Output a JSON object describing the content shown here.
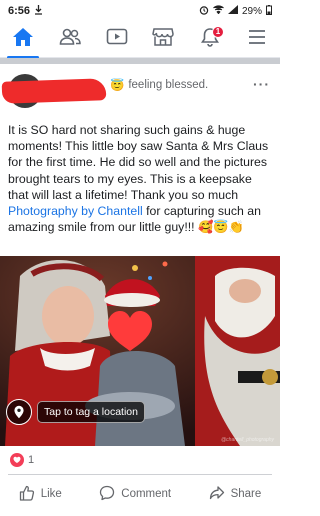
{
  "status_bar": {
    "time": "6:56",
    "battery": "29%"
  },
  "nav": {
    "tabs": [
      {
        "icon": "home-icon",
        "active": true
      },
      {
        "icon": "friends-icon"
      },
      {
        "icon": "watch-icon"
      },
      {
        "icon": "marketplace-icon"
      },
      {
        "icon": "notifications-icon",
        "badge": "1"
      },
      {
        "icon": "menu-icon"
      }
    ]
  },
  "post": {
    "feeling_emoji": "😇",
    "feeling": "feeling blessed.",
    "more": "···",
    "text_before_link": "It is SO hard not sharing such gains & huge moments! This little boy saw Santa & Mrs Claus for the first time. He did so well and the pictures brought tears to my eyes. This is a keepsake that will last a lifetime! Thank you so much ",
    "link_text": "Photography by Chantell",
    "text_after_link": " for capturing such an amazing smile from our little guy!!! 🥰😇👏",
    "tag_location": "Tap to tag a location",
    "watermark": "@chantell_photography",
    "reaction_count": "1"
  },
  "actions": {
    "like": "Like",
    "comment": "Comment",
    "share": "Share"
  },
  "colors": {
    "accent": "#1877f2",
    "link": "#1b74e4",
    "badge": "#e41e3f",
    "redaction": "#ee2b2b"
  }
}
